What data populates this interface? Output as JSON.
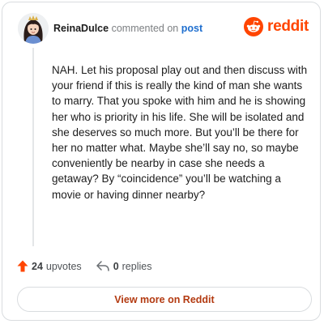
{
  "comment": {
    "username": "ReinaDulce",
    "action_text": "commented on",
    "target_link": "post",
    "body": "NAH. Let his proposal play out and then discuss with your friend if this is really the kind of man she wants to marry. That you spoke with him and he is showing her who is priority in his life. She will be isolated and she deserves so much more. But you’ll be there for her no matter what. Maybe she’ll say no, so maybe conveniently be nearby in case she needs a getaway? By “coincidence” you’ll be watching a movie or having dinner nearby?"
  },
  "brand": {
    "logo_text": "reddit",
    "icon": "reddit-alien-icon",
    "color": "#ff4500"
  },
  "stats": {
    "upvotes_count": "24",
    "upvotes_label": "upvotes",
    "upvote_icon": "upvote-arrow-icon",
    "replies_count": "0",
    "replies_label": "replies",
    "reply_icon": "reply-arrow-icon"
  },
  "actions": {
    "view_more_label": "View more on Reddit"
  }
}
